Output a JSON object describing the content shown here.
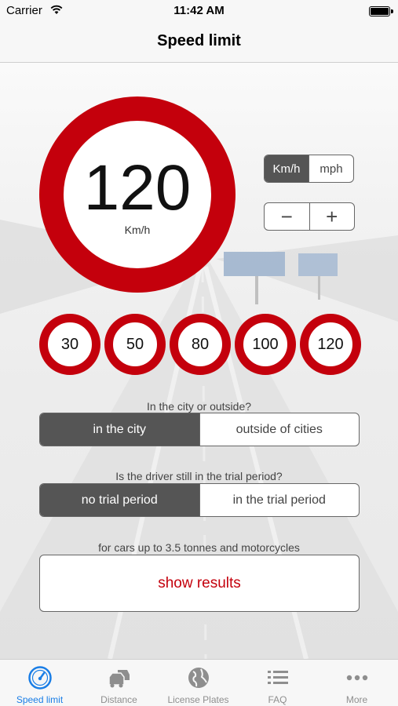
{
  "status_bar": {
    "carrier": "Carrier",
    "time": "11:42 AM"
  },
  "nav": {
    "title": "Speed limit"
  },
  "speed": {
    "value": "120",
    "unit": "Km/h"
  },
  "unit_toggle": {
    "options": [
      "Km/h",
      "mph"
    ],
    "selected": "Km/h"
  },
  "stepper": {
    "minus": "−",
    "plus": "+"
  },
  "presets": [
    "30",
    "50",
    "80",
    "100",
    "120"
  ],
  "location": {
    "question": "In the city or outside?",
    "options": [
      "in the city",
      "outside of cities"
    ],
    "selected": "in the city"
  },
  "trial": {
    "question": "Is the driver still in the trial period?",
    "options": [
      "no trial period",
      "in the trial period"
    ],
    "selected": "no trial period"
  },
  "vehicle_note": "for cars up to 3.5 tonnes and motorcycles",
  "show_results_label": "show results",
  "tabs": [
    {
      "label": "Speed limit",
      "icon": "speedometer-icon",
      "active": true
    },
    {
      "label": "Distance",
      "icon": "cars-icon",
      "active": false
    },
    {
      "label": "License Plates",
      "icon": "globe-icon",
      "active": false
    },
    {
      "label": "FAQ",
      "icon": "list-icon",
      "active": false
    },
    {
      "label": "More",
      "icon": "more-dots-icon",
      "active": false
    }
  ],
  "colors": {
    "accent_red": "#c4000c",
    "tab_active": "#1a7ee6",
    "segment_selected": "#555555"
  }
}
